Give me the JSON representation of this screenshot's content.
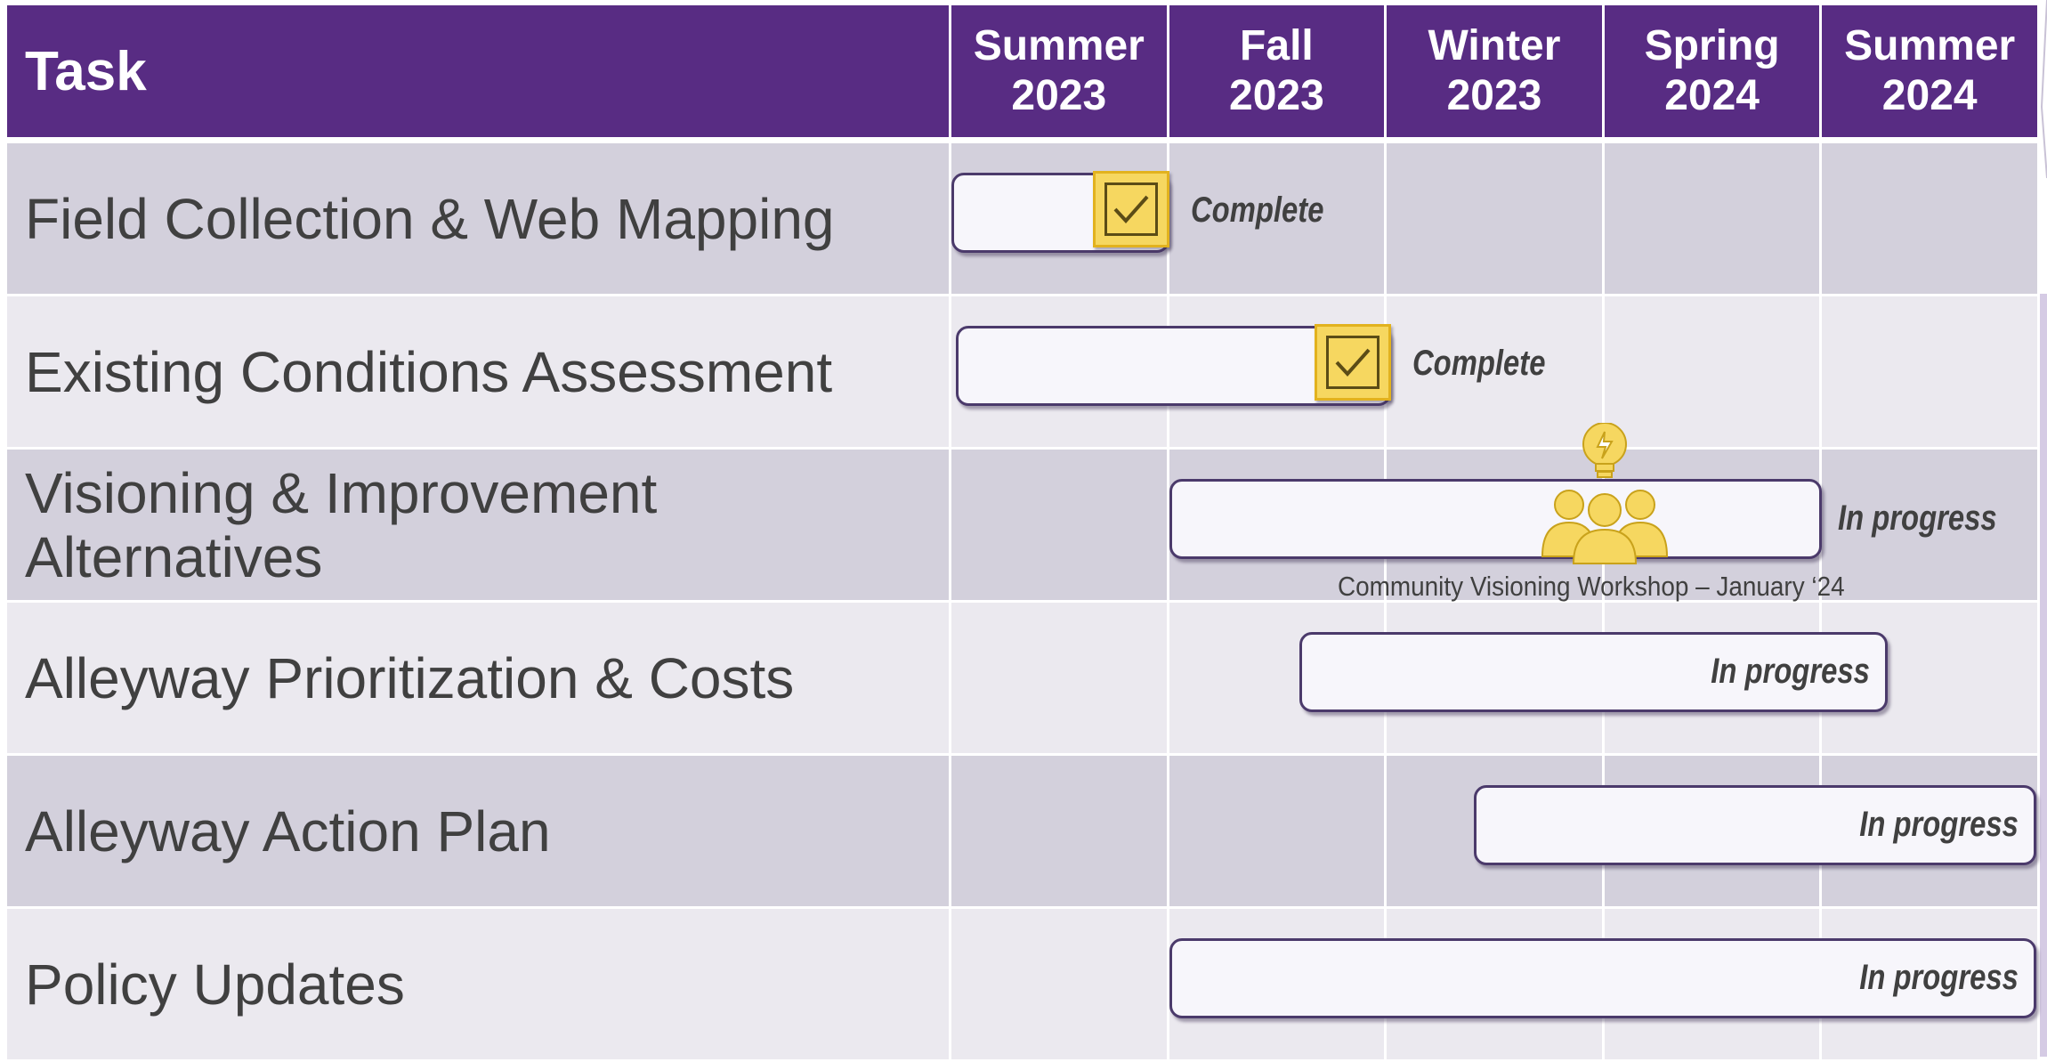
{
  "chart_data": {
    "type": "table",
    "header": {
      "task_label": "Task",
      "periods": [
        {
          "line1": "Summer",
          "line2": "2023"
        },
        {
          "line1": "Fall",
          "line2": "2023"
        },
        {
          "line1": "Winter",
          "line2": "2023"
        },
        {
          "line1": "Spring",
          "line2": "2024"
        },
        {
          "line1": "Summer",
          "line2": "2024"
        }
      ]
    },
    "tasks": [
      {
        "name": "Field Collection & Web Mapping",
        "start": 0.0,
        "end": 1.0,
        "status": "Complete",
        "checked": true
      },
      {
        "name": "Existing Conditions Assessment",
        "start": 0.02,
        "end": 2.02,
        "status": "Complete",
        "checked": true
      },
      {
        "name": "Visioning & Improvement\nAlternatives",
        "start": 1.0,
        "end": 4.0,
        "status": "In progress",
        "checked": false
      },
      {
        "name": "Alleyway Prioritization & Costs",
        "start": 1.6,
        "end": 4.3,
        "status": "In progress",
        "checked": false
      },
      {
        "name": "Alleyway Action Plan",
        "start": 2.4,
        "end": 5.0,
        "status": "In progress",
        "checked": false
      },
      {
        "name": "Policy Updates",
        "start": 1.0,
        "end": 5.0,
        "status": "In progress",
        "checked": false
      }
    ],
    "milestone": {
      "label": "Community Visioning Workshop – January ‘24",
      "task_index": 2,
      "position": 3.0,
      "icon": "lightbulb-people-icon"
    },
    "colors": {
      "header": "#582c83",
      "row_dark": "#d3d0dc",
      "row_light": "#ebe9ef",
      "bar_fill": "#f7f6fb",
      "bar_border": "#4b3a6b",
      "checkbox": "#f6d760",
      "text": "#404040"
    }
  }
}
